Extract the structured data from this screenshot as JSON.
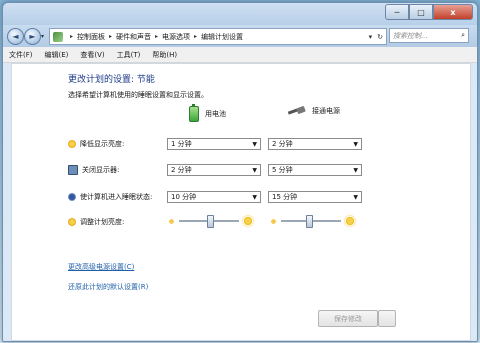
{
  "window": {
    "controls": {
      "minimize": "─",
      "maximize": "□",
      "close": "x"
    }
  },
  "nav": {
    "back_icon": "◄",
    "forward_icon": "►",
    "breadcrumbs": [
      "控制面板",
      "硬件和声音",
      "电源选项",
      "编辑计划设置"
    ],
    "separator": "▸",
    "refresh_icon": "↻",
    "search_placeholder": "搜索控制...",
    "search_icon": "⌕"
  },
  "menu": [
    "文件(F)",
    "编辑(E)",
    "查看(V)",
    "工具(T)",
    "帮助(H)"
  ],
  "page": {
    "title": "更改计划的设置: 节能",
    "subtitle": "选择希望计算机使用的睡眠设置和显示设置。",
    "col_battery": "用电池",
    "col_plugged": "接通电源"
  },
  "rows": [
    {
      "label": "降低显示亮度:",
      "battery": "1 分钟",
      "plugged": "2 分钟"
    },
    {
      "label": "关闭显示器:",
      "battery": "2 分钟",
      "plugged": "5 分钟"
    },
    {
      "label": "使计算机进入睡眠状态:",
      "battery": "10 分钟",
      "plugged": "15 分钟"
    }
  ],
  "brightness": {
    "label": "调整计划亮度:",
    "battery_level": 0.5,
    "plugged_level": 0.45
  },
  "links": {
    "advanced": "更改高级电源设置(C)",
    "restore": "还原此计划的默认设置(R)"
  },
  "buttons": {
    "save": "保存修改"
  }
}
